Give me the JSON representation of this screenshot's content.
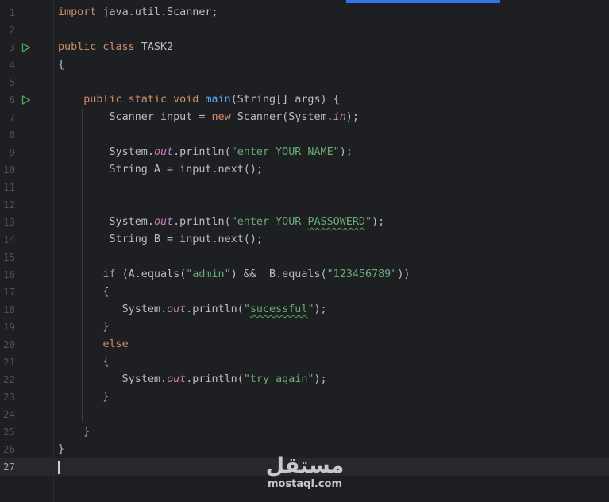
{
  "editor": {
    "lines": [
      {
        "num": "1",
        "tokens": [
          {
            "t": "kw",
            "v": "import"
          },
          {
            "t": "p",
            "v": " java.util.Scanner;"
          }
        ]
      },
      {
        "num": "2",
        "tokens": []
      },
      {
        "num": "3",
        "run": true,
        "tokens": [
          {
            "t": "kw",
            "v": "public class"
          },
          {
            "t": "p",
            "v": " TASK2"
          }
        ]
      },
      {
        "num": "4",
        "tokens": [
          {
            "t": "p",
            "v": "{"
          }
        ]
      },
      {
        "num": "5",
        "tokens": []
      },
      {
        "num": "6",
        "run": true,
        "tokens": [
          {
            "t": "p",
            "v": "    "
          },
          {
            "t": "kw",
            "v": "public static void"
          },
          {
            "t": "p",
            "v": " "
          },
          {
            "t": "fn",
            "v": "main"
          },
          {
            "t": "p",
            "v": "(String[] args) {"
          }
        ]
      },
      {
        "num": "7",
        "tokens": [
          {
            "t": "p",
            "v": "        Scanner input = "
          },
          {
            "t": "kw",
            "v": "new"
          },
          {
            "t": "p",
            "v": " Scanner(System."
          },
          {
            "t": "fld",
            "v": "in"
          },
          {
            "t": "p",
            "v": ");"
          }
        ]
      },
      {
        "num": "8",
        "tokens": []
      },
      {
        "num": "9",
        "tokens": [
          {
            "t": "p",
            "v": "        System."
          },
          {
            "t": "fld",
            "v": "out"
          },
          {
            "t": "p",
            "v": ".println("
          },
          {
            "t": "str",
            "v": "\"enter YOUR NAME\""
          },
          {
            "t": "p",
            "v": ");"
          }
        ]
      },
      {
        "num": "10",
        "tokens": [
          {
            "t": "p",
            "v": "        String A = input.next();"
          }
        ]
      },
      {
        "num": "11",
        "tokens": []
      },
      {
        "num": "12",
        "tokens": []
      },
      {
        "num": "13",
        "tokens": [
          {
            "t": "p",
            "v": "        System."
          },
          {
            "t": "fld",
            "v": "out"
          },
          {
            "t": "p",
            "v": ".println("
          },
          {
            "t": "str",
            "v": "\"enter YOUR "
          },
          {
            "t": "strtypo",
            "v": "PASSOWERD"
          },
          {
            "t": "str",
            "v": "\""
          },
          {
            "t": "p",
            "v": ");"
          }
        ]
      },
      {
        "num": "14",
        "tokens": [
          {
            "t": "p",
            "v": "        String B = input.next();"
          }
        ]
      },
      {
        "num": "15",
        "tokens": []
      },
      {
        "num": "16",
        "tokens": [
          {
            "t": "p",
            "v": "       "
          },
          {
            "t": "kw",
            "v": "if"
          },
          {
            "t": "p",
            "v": " (A.equals("
          },
          {
            "t": "str",
            "v": "\"admin\""
          },
          {
            "t": "p",
            "v": ") &&  B.equals("
          },
          {
            "t": "str",
            "v": "\"123456789\""
          },
          {
            "t": "p",
            "v": "))"
          }
        ]
      },
      {
        "num": "17",
        "tokens": [
          {
            "t": "p",
            "v": "       {"
          }
        ]
      },
      {
        "num": "18",
        "tokens": [
          {
            "t": "p",
            "v": "          System."
          },
          {
            "t": "fld",
            "v": "out"
          },
          {
            "t": "p",
            "v": ".println("
          },
          {
            "t": "str",
            "v": "\""
          },
          {
            "t": "strtypo",
            "v": "sucessful"
          },
          {
            "t": "str",
            "v": "\""
          },
          {
            "t": "p",
            "v": ");"
          }
        ]
      },
      {
        "num": "19",
        "tokens": [
          {
            "t": "p",
            "v": "       }"
          }
        ]
      },
      {
        "num": "20",
        "tokens": [
          {
            "t": "p",
            "v": "       "
          },
          {
            "t": "kw",
            "v": "else"
          }
        ]
      },
      {
        "num": "21",
        "tokens": [
          {
            "t": "p",
            "v": "       {"
          }
        ]
      },
      {
        "num": "22",
        "tokens": [
          {
            "t": "p",
            "v": "          System."
          },
          {
            "t": "fld",
            "v": "out"
          },
          {
            "t": "p",
            "v": ".println("
          },
          {
            "t": "str",
            "v": "\"try again\""
          },
          {
            "t": "p",
            "v": ");"
          }
        ]
      },
      {
        "num": "23",
        "tokens": [
          {
            "t": "p",
            "v": "       }"
          }
        ]
      },
      {
        "num": "24",
        "tokens": []
      },
      {
        "num": "25",
        "tokens": [
          {
            "t": "p",
            "v": "    }"
          }
        ]
      },
      {
        "num": "26",
        "tokens": [
          {
            "t": "p",
            "v": "}"
          }
        ]
      },
      {
        "num": "27",
        "current": true,
        "tokens": []
      }
    ]
  },
  "watermark": {
    "arabic": "مستقل",
    "latin": "mostaql.com"
  },
  "colors": {
    "background": "#1e1f22",
    "keyword": "#cf8e6d",
    "string": "#6aab73",
    "method": "#56a8f5",
    "field": "#c77dbb",
    "run_icon": "#4fa35a",
    "accent": "#3574f0"
  }
}
